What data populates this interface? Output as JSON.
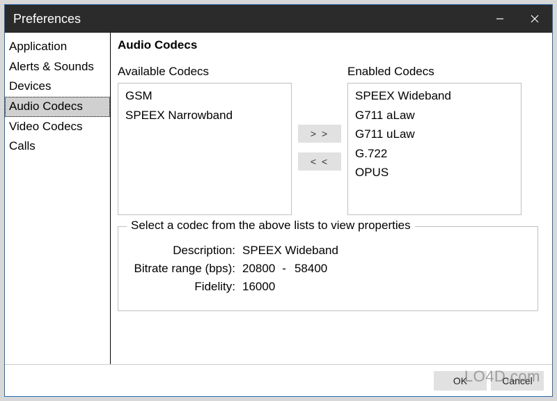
{
  "titlebar": {
    "title": "Preferences"
  },
  "sidebar": {
    "items": [
      {
        "label": "Application"
      },
      {
        "label": "Alerts & Sounds"
      },
      {
        "label": "Devices"
      },
      {
        "label": "Audio Codecs",
        "selected": true
      },
      {
        "label": "Video Codecs"
      },
      {
        "label": "Calls"
      }
    ]
  },
  "page": {
    "title": "Audio Codecs",
    "available_label": "Available Codecs",
    "enabled_label": "Enabled Codecs",
    "available": [
      "GSM",
      "SPEEX Narrowband"
    ],
    "enabled": [
      "SPEEX Wideband",
      "G711 aLaw",
      "G711 uLaw",
      "G.722",
      "OPUS"
    ],
    "shuttle": {
      "add": "> >",
      "remove": "< <"
    },
    "props": {
      "legend": "Select a codec from the above lists to view properties",
      "description_label": "Description:",
      "description_value": "SPEEX Wideband",
      "bitrate_label": "Bitrate range (bps):",
      "bitrate_low": "20800",
      "bitrate_sep": "-",
      "bitrate_high": "58400",
      "fidelity_label": "Fidelity:",
      "fidelity_value": "16000"
    }
  },
  "buttons": {
    "ok": "OK",
    "cancel": "Cancel"
  },
  "watermark": "LO4D.com"
}
